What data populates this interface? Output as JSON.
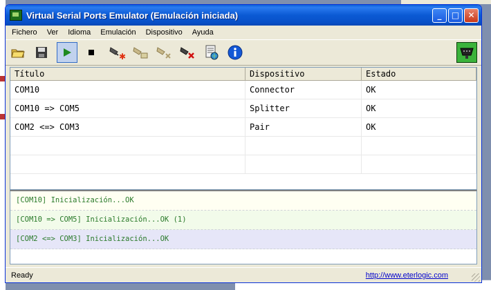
{
  "window": {
    "title": "Virtual Serial Ports Emulator (Emulación iniciada)",
    "controls": {
      "minimize": "_",
      "maximize": "□",
      "close": "✕"
    }
  },
  "menu": [
    "Fichero",
    "Ver",
    "Idioma",
    "Emulación",
    "Dispositivo",
    "Ayuda"
  ],
  "toolbar": {
    "buttons": [
      "open-icon",
      "save-icon",
      "play-icon",
      "stop-icon",
      "device-add-icon",
      "device-edit-icon",
      "device-remove-icon",
      "device-delete-icon",
      "report-icon",
      "info-icon"
    ],
    "emulation_running": true
  },
  "table": {
    "headers": [
      "Título",
      "Dispositivo",
      "Estado"
    ],
    "rows": [
      [
        "COM10",
        "Connector",
        "OK"
      ],
      [
        "COM10 => COM5",
        "Splitter",
        "OK"
      ],
      [
        "COM2 <=> COM3",
        "Pair",
        "OK"
      ]
    ]
  },
  "log": [
    "[COM10] Inicialización...OK",
    "[COM10 => COM5] Inicialización...OK (1)",
    "[COM2 <=> COM3] Inicialización...OK"
  ],
  "status": {
    "text": "Ready",
    "link": "http://www.eterlogic.com"
  },
  "colors": {
    "titlebar": "#0a5fd8",
    "log_text": "#2a7a2a",
    "link": "#0000cc"
  }
}
